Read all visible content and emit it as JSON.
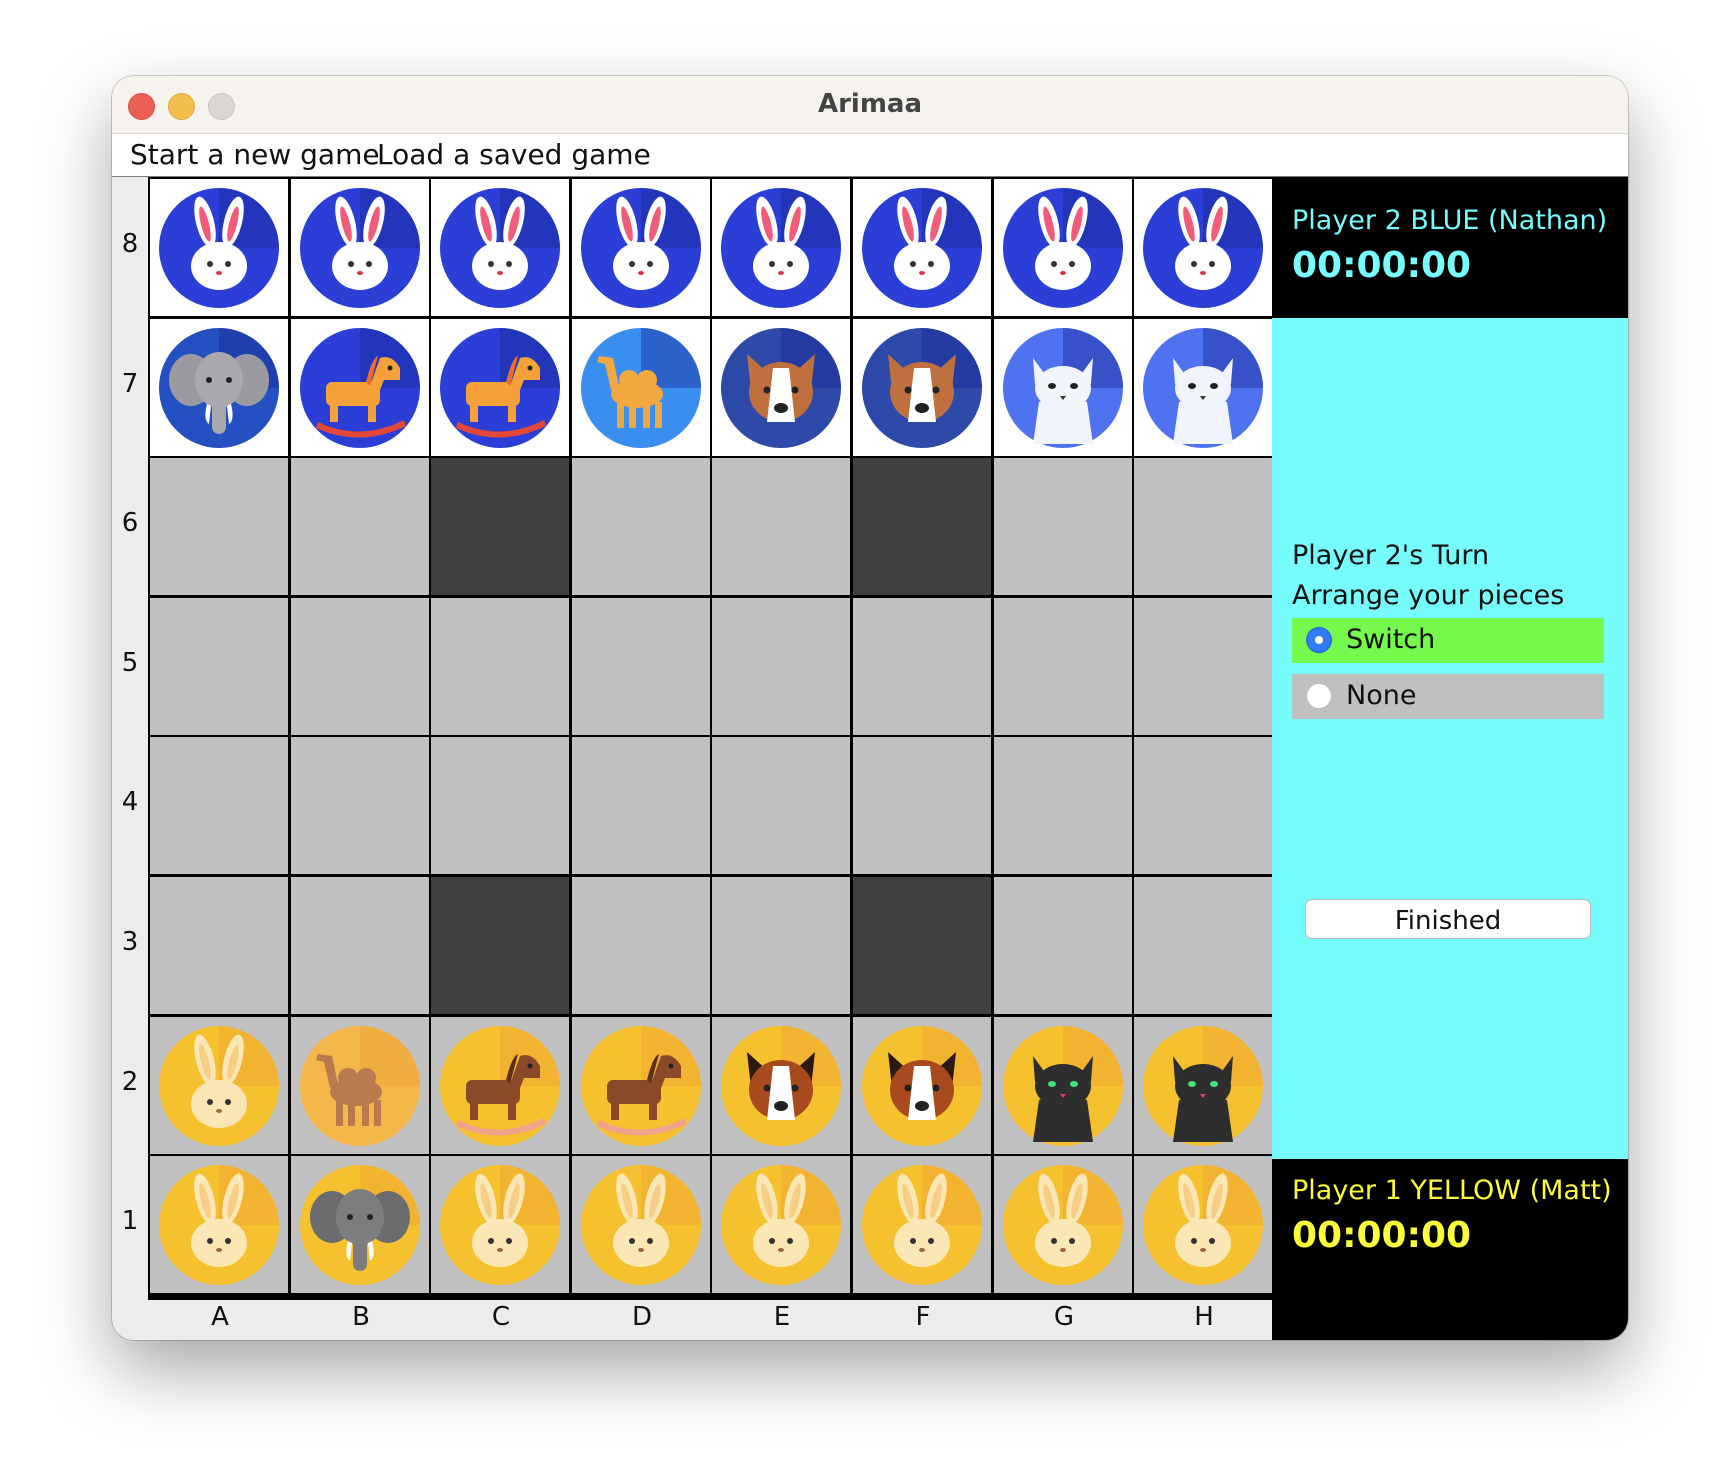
{
  "window": {
    "title": "Arimaa"
  },
  "menu": {
    "new_game": "Start a new game",
    "load_game": "Load a saved game"
  },
  "board": {
    "ranks": [
      "8",
      "7",
      "6",
      "5",
      "4",
      "3",
      "2",
      "1"
    ],
    "files": [
      "A",
      "B",
      "C",
      "D",
      "E",
      "F",
      "G",
      "H"
    ],
    "traps": [
      "C6",
      "F6",
      "C3",
      "F3"
    ],
    "pieces": {
      "blue_rank8": [
        "rabbit",
        "rabbit",
        "rabbit",
        "rabbit",
        "rabbit",
        "rabbit",
        "rabbit",
        "rabbit"
      ],
      "blue_rank7": [
        "elephant",
        "horse",
        "horse",
        "camel",
        "dog",
        "dog",
        "cat",
        "cat"
      ],
      "yellow_rank2": [
        "rabbit",
        "camel",
        "horse",
        "horse",
        "dog",
        "dog",
        "cat",
        "cat"
      ],
      "yellow_rank1": [
        "rabbit",
        "elephant",
        "rabbit",
        "rabbit",
        "rabbit",
        "rabbit",
        "rabbit",
        "rabbit"
      ]
    }
  },
  "player2": {
    "name": "Player 2 BLUE (Nathan)",
    "clock": "00:00:00",
    "color": "#76fcfc"
  },
  "player1": {
    "name": "Player 1 YELLOW (Matt)",
    "clock": "00:00:00",
    "color": "#fcfc3a"
  },
  "turn": {
    "status": "Player 2's Turn",
    "instruction": "Arrange your pieces",
    "options": [
      "Switch",
      "None"
    ],
    "selected_option": "Switch",
    "finish_label": "Finished"
  },
  "colors": {
    "panel": "#76fcfc",
    "selected_option": "#74f94c",
    "trap": "#404040",
    "empty": "#c1c1c1"
  }
}
